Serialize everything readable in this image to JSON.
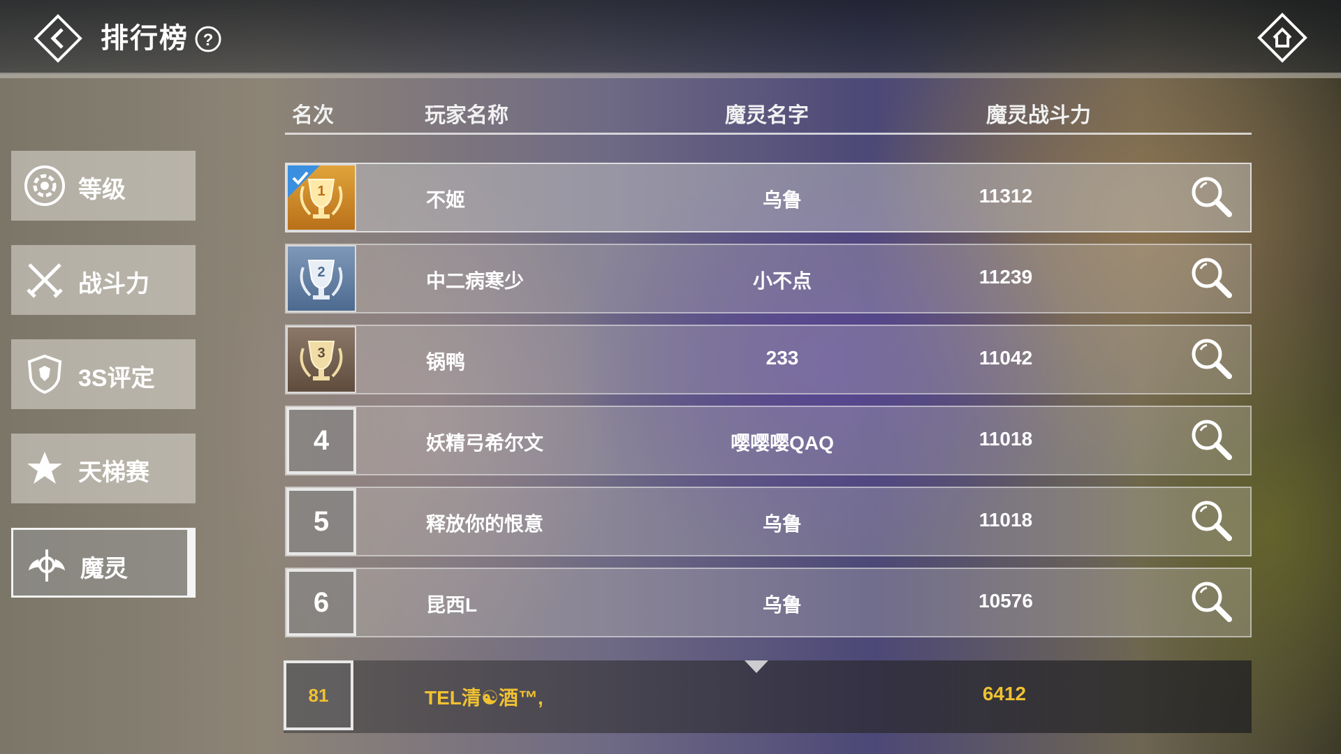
{
  "header": {
    "title": "排行榜",
    "help_label": "?"
  },
  "sidebar": {
    "items": [
      {
        "label": "等级",
        "icon": "gear-badge-icon",
        "active": false
      },
      {
        "label": "战斗力",
        "icon": "crossed-swords-icon",
        "active": false
      },
      {
        "label": "3S评定",
        "icon": "shield-crest-icon",
        "active": false
      },
      {
        "label": "天梯赛",
        "icon": "star-icon",
        "active": false
      },
      {
        "label": "魔灵",
        "icon": "winged-emblem-icon",
        "active": true
      }
    ]
  },
  "table": {
    "columns": [
      "名次",
      "玩家名称",
      "魔灵名字",
      "魔灵战斗力"
    ],
    "rows": [
      {
        "rank": "1",
        "player": "不姬",
        "spirit": "乌鲁",
        "power": "11312",
        "badge": "gold-trophy"
      },
      {
        "rank": "2",
        "player": "中二病寒少",
        "spirit": "小不点",
        "power": "11239",
        "badge": "silver-trophy"
      },
      {
        "rank": "3",
        "player": "锅鸭",
        "spirit": "233",
        "power": "11042",
        "badge": "bronze-trophy"
      },
      {
        "rank": "4",
        "player": "妖精弓希尔文",
        "spirit": "嘤嘤嘤QAQ",
        "power": "11018",
        "badge": "number"
      },
      {
        "rank": "5",
        "player": "释放你的恨意",
        "spirit": "乌鲁",
        "power": "11018",
        "badge": "number"
      },
      {
        "rank": "6",
        "player": "昆西L",
        "spirit": "乌鲁",
        "power": "10576",
        "badge": "number"
      }
    ]
  },
  "my_entry": {
    "rank": "81",
    "player": "TEL清☯酒™,",
    "power": "6412"
  },
  "colors": {
    "highlight_gold": "#f0c232",
    "check_blue": "#3a8fe0"
  }
}
